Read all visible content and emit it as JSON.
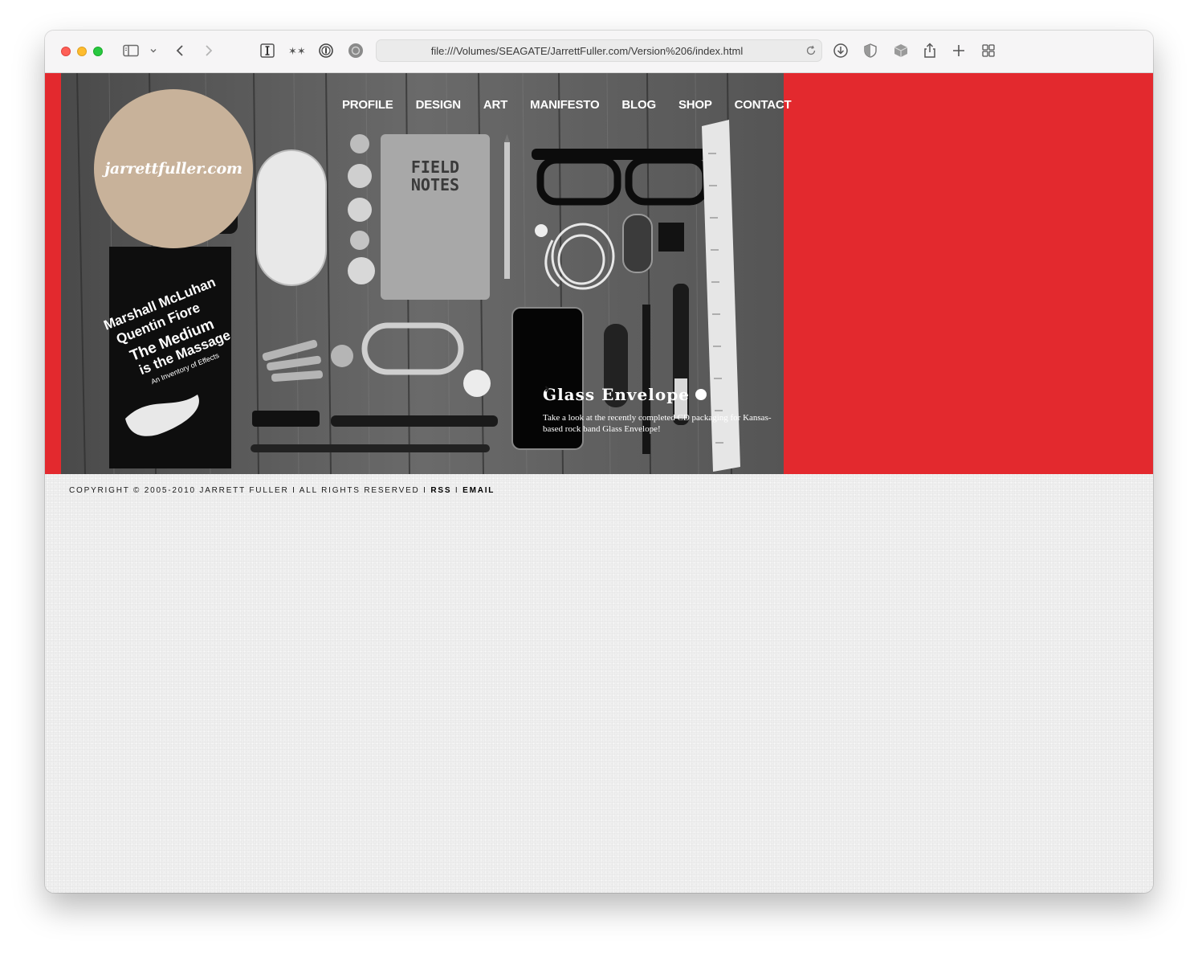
{
  "browser": {
    "url": "file:///Volumes/SEAGATE/JarrettFuller.com/Version%206/index.html",
    "icons": [
      "sidebar-icon",
      "chevron-down-icon",
      "back-icon",
      "forward-icon",
      "reader-icon",
      "extension-icon",
      "password-icon",
      "privacy-icon",
      "reload-icon",
      "download-icon",
      "shield-icon",
      "box-icon",
      "share-icon",
      "new-tab-icon",
      "tab-overview-icon"
    ]
  },
  "site": {
    "logo": "jarrettfuller.com",
    "nav": [
      "PROFILE",
      "DESIGN",
      "ART",
      "MANIFESTO",
      "BLOG",
      "SHOP",
      "CONTACT"
    ],
    "feature": {
      "title": "Glass Envelope",
      "description": "Take a look at the recently completed CD packaging for Kansas-based rock band Glass Envelope!"
    },
    "photo_text": {
      "notebook_line1": "FIELD",
      "notebook_line2": "NOTES",
      "book_line1": "Marshall McLuhan",
      "book_line2": "Quentin Fiore",
      "book_line3": "The Medium",
      "book_line4": "is the Massage",
      "book_line5": "An Inventory of Effects"
    },
    "footer": {
      "copyright": "COPYRIGHT © 2005-2010 JARRETT FULLER",
      "rights": "ALL RIGHTS RESERVED",
      "separator": "I",
      "rss": "RSS",
      "email": "EMAIL"
    }
  },
  "colors": {
    "band": "#e3292e",
    "logo_circle": "#c8b29a",
    "page_bg": "#efefef"
  }
}
